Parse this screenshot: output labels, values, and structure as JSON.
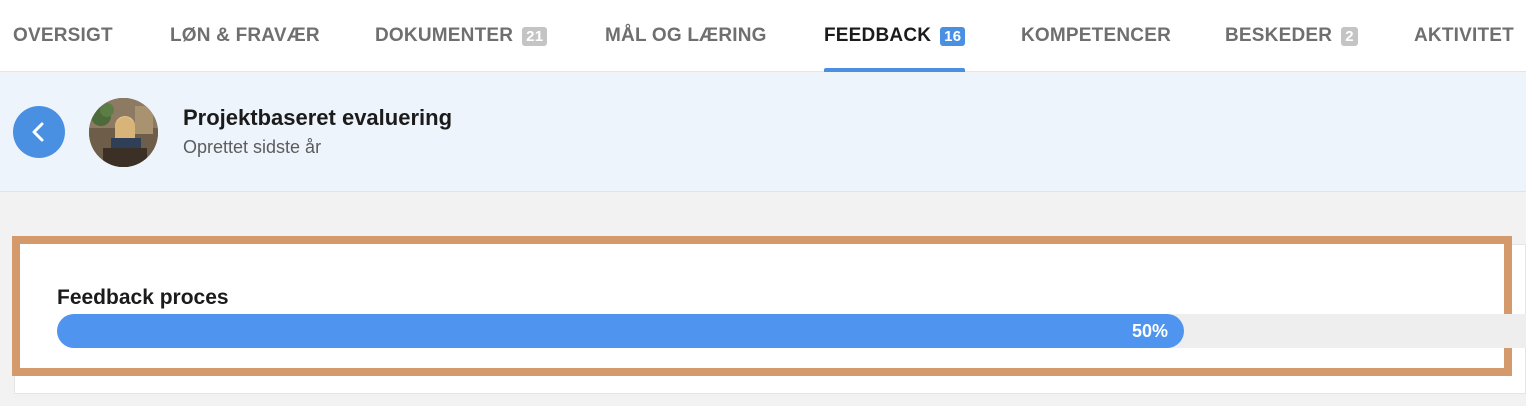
{
  "tabs": [
    {
      "label": "OVERSIGT",
      "badge": null,
      "active": false
    },
    {
      "label": "LØN & FRAVÆR",
      "badge": null,
      "active": false
    },
    {
      "label": "DOKUMENTER",
      "badge": "21",
      "active": false
    },
    {
      "label": "MÅL OG LÆRING",
      "badge": null,
      "active": false
    },
    {
      "label": "FEEDBACK",
      "badge": "16",
      "active": true
    },
    {
      "label": "KOMPETENCER",
      "badge": null,
      "active": false
    },
    {
      "label": "BESKEDER",
      "badge": "2",
      "active": false
    },
    {
      "label": "AKTIVITET",
      "badge": null,
      "active": false
    }
  ],
  "header": {
    "title": "Projektbaseret evaluering",
    "subtitle": "Oprettet sidste år",
    "back_icon": "chevron-left-icon",
    "avatar": "user-photo"
  },
  "feedback": {
    "title": "Feedback proces",
    "progress_label": "50%",
    "progress_fraction": 0.5
  },
  "colors": {
    "accent": "#4a90e2",
    "progress": "#4f94ef",
    "highlight_border": "#d59a6c",
    "header_bg": "#eef4fb"
  }
}
